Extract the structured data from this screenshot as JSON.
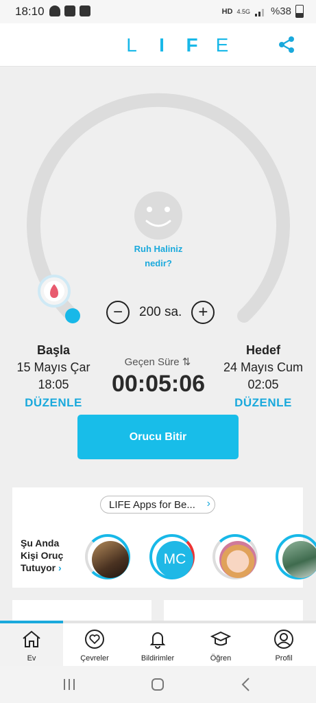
{
  "status": {
    "time": "18:10",
    "net_label": "4.5G",
    "battery": "%38"
  },
  "header": {
    "logo_letters": [
      "L",
      "I",
      "F",
      "E"
    ]
  },
  "mood": {
    "line1": "Ruh Haliniz",
    "line2": "nedir?"
  },
  "duration": {
    "decrement": "−",
    "value": "200 sa.",
    "increment": "+"
  },
  "start": {
    "title": "Başla",
    "date": "15 Mayıs Çar",
    "time": "18:05",
    "edit": "DÜZENLE"
  },
  "target": {
    "title": "Hedef",
    "date": "24 Mayıs Cum",
    "time": "02:05",
    "edit": "DÜZENLE"
  },
  "elapsed": {
    "label": "Geçen Süre ⇅",
    "value": "00:05:06"
  },
  "primary": {
    "end_fast": "Orucu Bitir"
  },
  "apps": {
    "pill": "LIFE Apps for Be...",
    "fasting_now": [
      "Şu Anda",
      "Kişi Oruç",
      "Tutuyor"
    ],
    "avatar_initials": "MC"
  },
  "tabs": [
    {
      "label": "Ev",
      "icon": "home-icon"
    },
    {
      "label": "Çevreler",
      "icon": "heart-circle-icon"
    },
    {
      "label": "Bildirimler",
      "icon": "bell-icon"
    },
    {
      "label": "Öğren",
      "icon": "graduation-cap-icon"
    },
    {
      "label": "Profil",
      "icon": "profile-icon"
    }
  ],
  "colors": {
    "accent": "#18bde9",
    "ring": "#dddddd",
    "text": "#222222"
  }
}
